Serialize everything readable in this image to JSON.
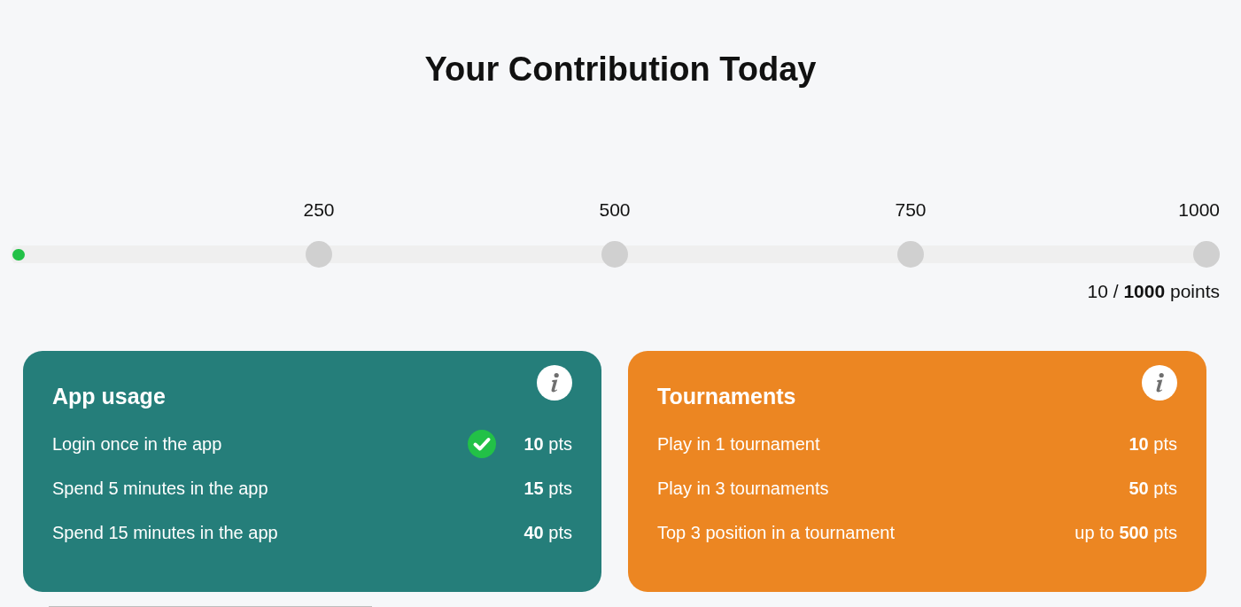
{
  "title": "Your Contribution Today",
  "progress": {
    "level": 0.01,
    "milestones": [
      "250",
      "500",
      "750",
      "1000"
    ],
    "summary": "10 / **1000** points"
  },
  "cards": [
    {
      "title": "App usage",
      "color": "#257e7a",
      "tasks": [
        {
          "label": "Login once in the app",
          "done": true,
          "points": "**10** pts"
        },
        {
          "label": "Spend 5 minutes in the app",
          "done": false,
          "points": "**15** pts"
        },
        {
          "label": "Spend 15 minutes in the app",
          "done": false,
          "points": "**40** pts"
        }
      ]
    },
    {
      "title": "Tournaments",
      "color": "#ec8622",
      "tasks": [
        {
          "label": "Play in 1 tournament",
          "done": false,
          "points": "**10** pts"
        },
        {
          "label": "Play in 3 tournaments",
          "done": false,
          "points": "**50** pts"
        },
        {
          "label": "Top 3 position in a tournament",
          "done": false,
          "points": "up to **500** pts"
        }
      ]
    }
  ]
}
